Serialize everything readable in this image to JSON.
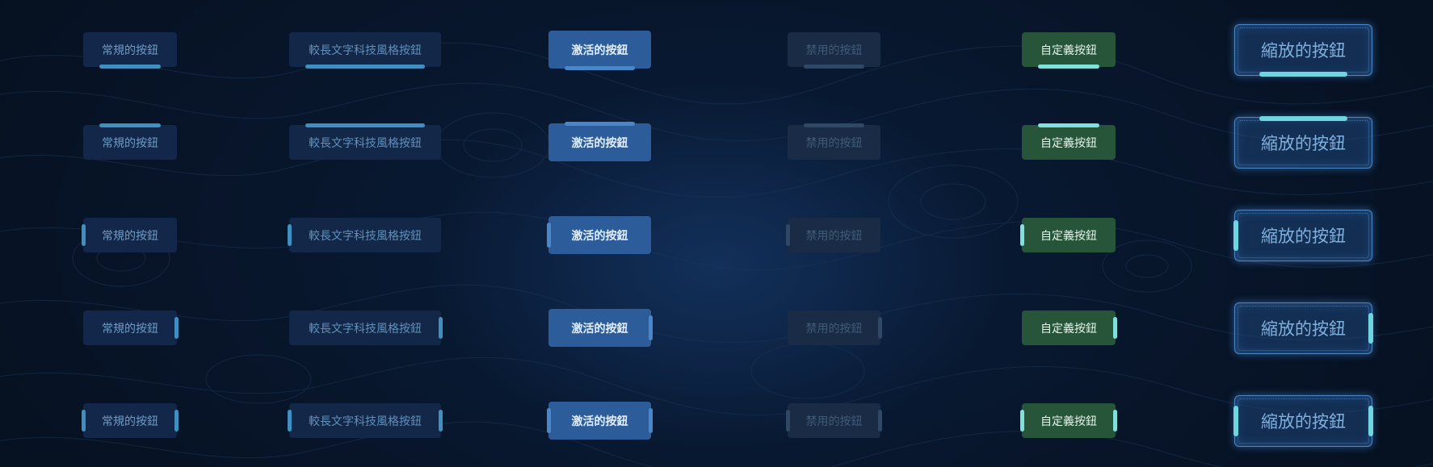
{
  "buttons": {
    "normal": "常規的按鈕",
    "long": "較長文字科技風格按鈕",
    "active": "激活的按鈕",
    "disabled": "禁用的按鈕",
    "custom": "自定義按鈕",
    "zoom": "縮放的按鈕"
  },
  "accent_variants": [
    "bottom",
    "top",
    "left",
    "right",
    "left-right"
  ],
  "colors": {
    "background": "#06101f",
    "normal_bg": "#12274a",
    "active_bg": "#2c5d9a",
    "disabled_bg": "#1a2c45",
    "custom_bg": "#26553a",
    "accent_blue": "#3f8fc0",
    "accent_cyan": "#7fe0dc"
  }
}
